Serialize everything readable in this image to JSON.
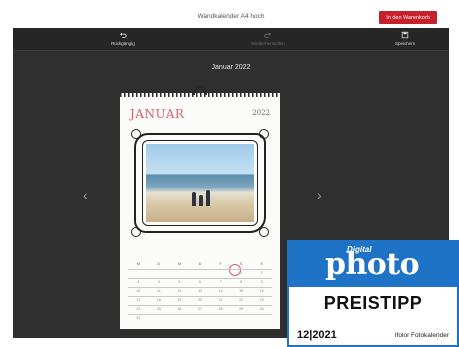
{
  "header": {
    "title": "Wandkalender A4 hoch",
    "cart_button": "In den Warenkorb"
  },
  "toolbar": {
    "undo": "Rückgängig",
    "shuffle": "Wiederherstellen",
    "save": "Speichern"
  },
  "editor": {
    "page_label": "Januar 2022",
    "prev_arrow": "‹",
    "next_arrow": "›"
  },
  "calendar": {
    "month": "JANUAR",
    "year": "2022",
    "weekdays": [
      "M",
      "D",
      "M",
      "D",
      "F",
      "S",
      "S"
    ],
    "weeks": [
      [
        "",
        "",
        "",
        "",
        "",
        "1",
        "2"
      ],
      [
        "3",
        "4",
        "5",
        "6",
        "7",
        "8",
        "9"
      ],
      [
        "10",
        "11",
        "12",
        "13",
        "14",
        "15",
        "16"
      ],
      [
        "17",
        "18",
        "19",
        "20",
        "21",
        "22",
        "23"
      ],
      [
        "24",
        "25",
        "26",
        "27",
        "28",
        "29",
        "30"
      ],
      [
        "31",
        "",
        "",
        "",
        "",
        "",
        ""
      ]
    ]
  },
  "badge": {
    "brand_prefix": "Digital",
    "brand": "photo",
    "award": "PREISTIPP",
    "issue": "12|2021",
    "category": "Ifolor Fotokalender",
    "color": "#1f73c6"
  },
  "colors": {
    "accent": "#c8202b",
    "workspace": "#2f2f2f",
    "month_title": "#d8606b"
  }
}
